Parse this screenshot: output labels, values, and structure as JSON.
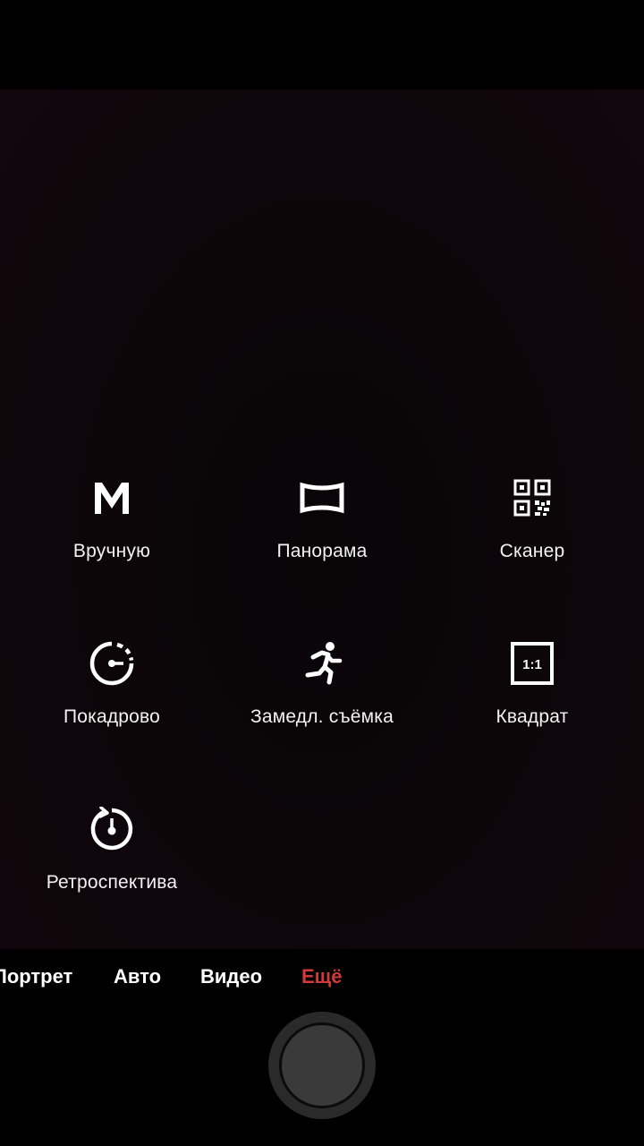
{
  "modes": [
    {
      "id": "manual",
      "label": "Вручную",
      "icon": "manual-m-icon"
    },
    {
      "id": "panorama",
      "label": "Панорама",
      "icon": "panorama-icon"
    },
    {
      "id": "scanner",
      "label": "Сканер",
      "icon": "qr-code-icon"
    },
    {
      "id": "timelapse",
      "label": "Покадрово",
      "icon": "timelapse-dial-icon"
    },
    {
      "id": "slowmo",
      "label": "Замедл. съёмка",
      "icon": "running-person-icon"
    },
    {
      "id": "square",
      "label": "Квадрат",
      "icon": "square-ratio-icon",
      "icon_text": "1:1"
    },
    {
      "id": "retrospective",
      "label": "Ретроспектива",
      "icon": "retrospective-timer-icon"
    }
  ],
  "tabs": [
    {
      "label": "Портрет",
      "active": false
    },
    {
      "label": "Авто",
      "active": false
    },
    {
      "label": "Видео",
      "active": false
    },
    {
      "label": "Ещё",
      "active": true
    }
  ],
  "colors": {
    "accent": "#d23a3a",
    "label": "#f2f2f2",
    "background": "#000000"
  }
}
